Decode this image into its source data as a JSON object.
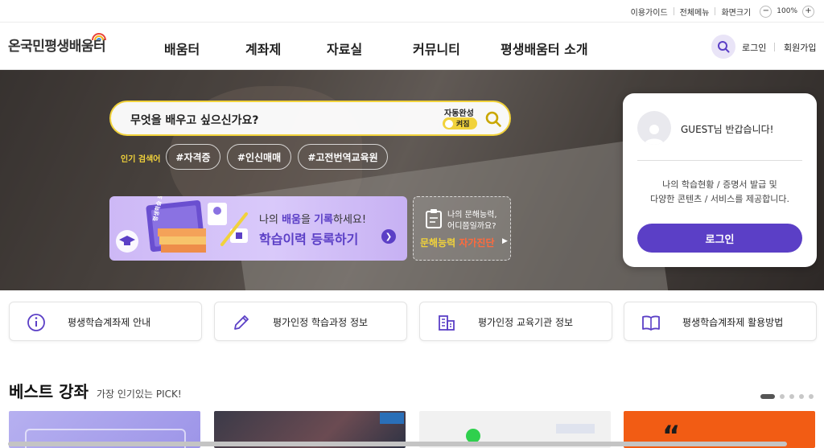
{
  "utility": {
    "guide": "이용가이드",
    "all_menu": "전체메뉴",
    "zoom_label": "화면크기",
    "zoom_out": "−",
    "zoom_value": "100%",
    "zoom_in": "+"
  },
  "header": {
    "logo": "온국민평생배움터",
    "nav": [
      "배움터",
      "계좌제",
      "자료실",
      "커뮤니티",
      "평생배움터 소개"
    ],
    "login": "로그인",
    "signup": "회원가입"
  },
  "hero": {
    "search_placeholder": "무엇을 배우고 싶으신가요?",
    "autocomplete_label": "자동완성",
    "autocomplete_state": "켜짐",
    "popular_label": "인기 검색어",
    "tags": [
      "#자격증",
      "#인신매매",
      "#고전번역교육원"
    ],
    "banner_main": {
      "pre": "나의 ",
      "em1": "배움",
      "mid": "을 ",
      "em2": "기록",
      "post": "하세요!",
      "title": "학습이력 등록하기",
      "book_label": "평생학습 포트폴리오"
    },
    "banner_sub": {
      "line1": "나의 문해능력,",
      "line2": "어디쯤일까요?",
      "title_a": "문해능력 ",
      "title_b": "자가진단"
    }
  },
  "login_card": {
    "greeting": "GUEST님 반갑습니다!",
    "desc_line1": "나의 학습현황 / 증명서 발급 및",
    "desc_line2": "다양한 콘텐츠 / 서비스를 제공합니다.",
    "button": "로그인"
  },
  "quick_links": [
    {
      "label": "평생학습계좌제 안내",
      "icon": "info-icon"
    },
    {
      "label": "평가인정 학습과정 정보",
      "icon": "pencil-icon"
    },
    {
      "label": "평가인정 교육기관 정보",
      "icon": "building-icon"
    },
    {
      "label": "평생학습계좌제 활용방법",
      "icon": "book-icon"
    }
  ],
  "best": {
    "title": "베스트 강좌",
    "subtitle": "가장 인기있는 PICK!",
    "slide_count": 5,
    "active_slide": 1
  },
  "colors": {
    "brand_purple": "#5b3fc6",
    "accent_yellow": "#f1d23b"
  }
}
